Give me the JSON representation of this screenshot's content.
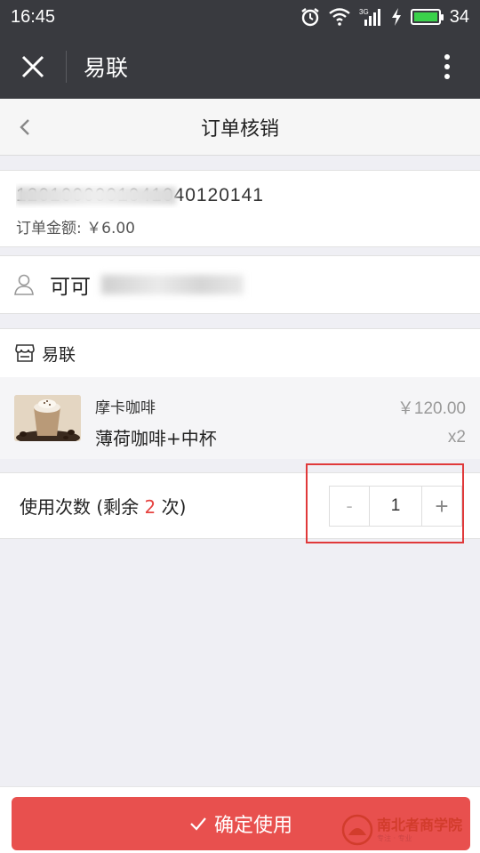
{
  "status_bar": {
    "time": "16:45",
    "battery_level": "34",
    "icons": [
      "alarm-icon",
      "wifi-icon",
      "signal-3g-icon",
      "charging-icon",
      "battery-icon"
    ]
  },
  "wechat_bar": {
    "title": "易联",
    "close_icon": "close-icon",
    "more_icon": "more-vertical-icon"
  },
  "page": {
    "title": "订单核销",
    "back_icon": "chevron-left-icon"
  },
  "order": {
    "number_visible": "1201000001041040120141",
    "amount_label": "订单金额: ￥6.00"
  },
  "user": {
    "name": "可可"
  },
  "shop": {
    "name": "易联",
    "item": {
      "name": "摩卡咖啡",
      "spec": "薄荷咖啡+中杯",
      "price": "￥120.00",
      "quantity": "x2"
    }
  },
  "usage": {
    "label_prefix": "使用次数 (剩余 ",
    "remaining": "2",
    "label_suffix": " 次)",
    "minus": "-",
    "value": "1",
    "plus": "+"
  },
  "confirm_button": {
    "label": "确定使用"
  },
  "watermark": {
    "text": "南北者商学院",
    "sub": "专注 · 专业"
  },
  "colors": {
    "topbar": "#393a3f",
    "accent_red": "#e8504e",
    "highlight_red": "#e0393a",
    "battery_green": "#3ad14a"
  }
}
